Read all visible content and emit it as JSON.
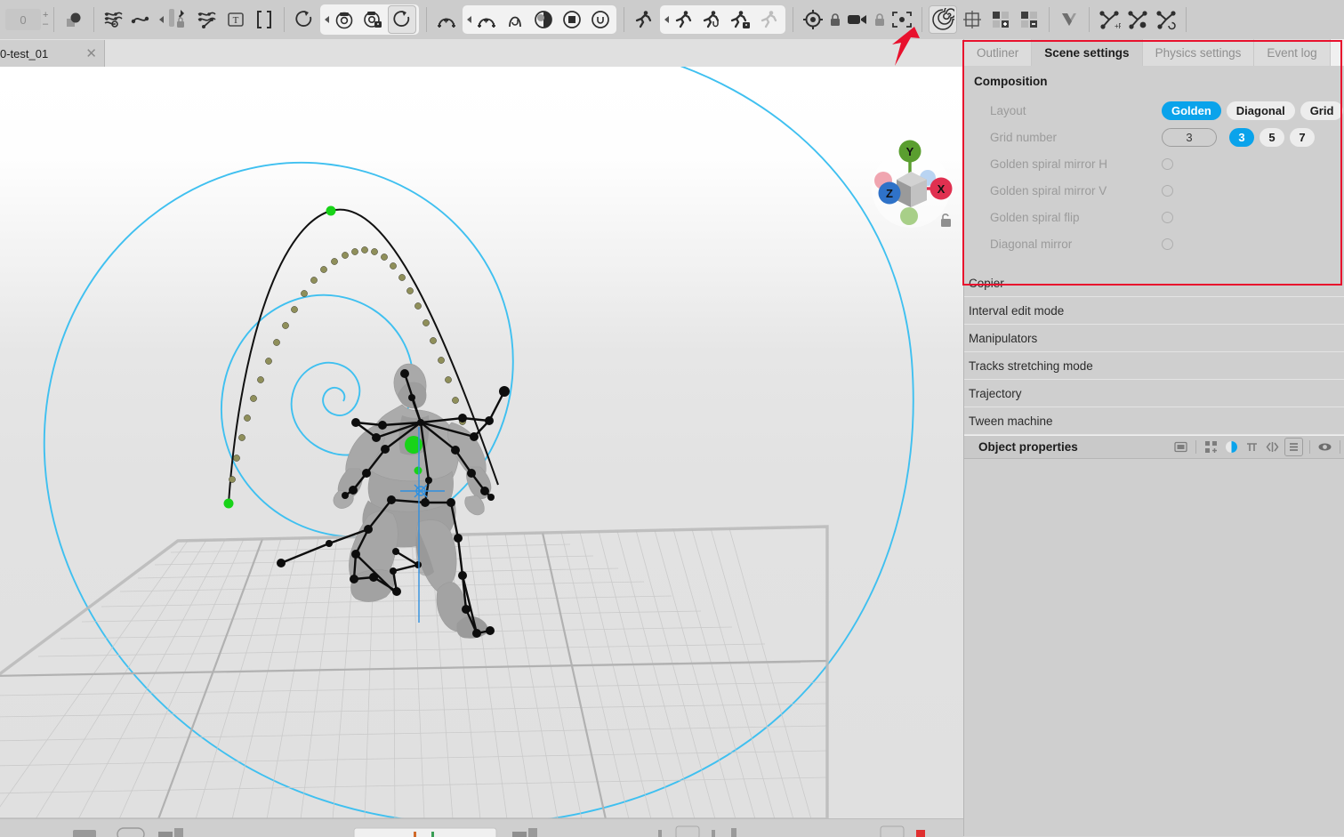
{
  "app": {
    "document_tab": {
      "label": "0-test_01",
      "close": "✕"
    },
    "frame_spinner": {
      "value": "0",
      "increase": "+",
      "decrease": "–"
    }
  },
  "toolbar": {
    "groups": [
      {
        "name": "frame-counter",
        "buttons": []
      },
      {
        "name": "selection-tools",
        "buttons": [
          {
            "name": "ball-shape-tool-button",
            "icon": "ball-shape-icon"
          }
        ]
      },
      {
        "name": "track-tools",
        "buttons": [
          {
            "name": "tracks-overview-button",
            "icon": "tracks-eye-icon"
          },
          {
            "name": "smooth-track-button",
            "icon": "smooth-wave-icon"
          },
          {
            "name": "pin-track-button",
            "icon": "pin-lock-icon"
          },
          {
            "name": "tracks-edit-button",
            "icon": "tracks-edit-icon"
          },
          {
            "name": "text-tool-button",
            "icon": "text-box-icon"
          },
          {
            "name": "interval-brackets-button",
            "icon": "brackets-icon"
          }
        ]
      },
      {
        "name": "camera-tools",
        "buttons": [
          {
            "name": "rotate-free-button",
            "icon": "rotate-arrow-icon"
          },
          {
            "name": "camera-snapshot-button",
            "icon": "camera-icon"
          },
          {
            "name": "camera-lock-button",
            "icon": "camera-lock-icon"
          },
          {
            "name": "rotate-view-button",
            "icon": "rotate-arrow-icon"
          }
        ]
      },
      {
        "name": "physics-tools",
        "buttons": [
          {
            "name": "ballistic-arc-button",
            "icon": "arc-plus-icon"
          },
          {
            "name": "ballistic-arc-alt-button",
            "icon": "arc-plus-icon"
          },
          {
            "name": "arc-partial-button",
            "icon": "arc-u-icon"
          },
          {
            "name": "center-of-mass-button",
            "icon": "com-ball-icon"
          },
          {
            "name": "inertia-box-button",
            "icon": "inertia-box-icon"
          },
          {
            "name": "momentum-button",
            "icon": "momentum-u-icon"
          }
        ]
      },
      {
        "name": "character-tools",
        "buttons": [
          {
            "name": "run-pose-button",
            "icon": "runner-icon"
          },
          {
            "name": "run-pose-alt-button",
            "icon": "runner-icon"
          },
          {
            "name": "run-undo-button",
            "icon": "runner-undo-icon"
          },
          {
            "name": "run-lock-button",
            "icon": "runner-lock-icon"
          },
          {
            "name": "run-disabled-button",
            "icon": "runner-ghost-icon"
          }
        ]
      },
      {
        "name": "viewport-tools",
        "buttons": [
          {
            "name": "target-point-button",
            "icon": "target-icon"
          },
          {
            "name": "target-lock-button",
            "icon": "small-lock-icon"
          },
          {
            "name": "camera-object-button",
            "icon": "video-camera-icon"
          },
          {
            "name": "camera-object-lock-button",
            "icon": "small-lock-icon"
          },
          {
            "name": "focus-frame-button",
            "icon": "focus-brackets-icon"
          }
        ]
      },
      {
        "name": "composition-tools",
        "buttons": [
          {
            "name": "golden-spiral-overlay-button",
            "icon": "spiral-icon"
          },
          {
            "name": "grid-overlay-button",
            "icon": "grid-overlay-icon"
          },
          {
            "name": "add-layer-button",
            "icon": "squares-plus-icon"
          },
          {
            "name": "remove-layer-button",
            "icon": "squares-minus-icon"
          }
        ]
      },
      {
        "name": "shape-tools",
        "buttons": [
          {
            "name": "chevron-shape-button",
            "icon": "chevron-v-icon"
          }
        ]
      },
      {
        "name": "node-tools",
        "buttons": [
          {
            "name": "add-node-button",
            "icon": "node-plus-icon"
          },
          {
            "name": "node-point-button",
            "icon": "node-dot-icon"
          },
          {
            "name": "reset-node-button",
            "icon": "node-reset-icon"
          }
        ]
      }
    ]
  },
  "panel": {
    "tabs": [
      {
        "label": "Outliner",
        "selected": false
      },
      {
        "label": "Scene settings",
        "selected": true
      },
      {
        "label": "Physics settings",
        "selected": false
      },
      {
        "label": "Event log",
        "selected": false
      }
    ],
    "composition": {
      "title": "Composition",
      "layout": {
        "label": "Layout",
        "options": [
          {
            "label": "Golden",
            "selected": true
          },
          {
            "label": "Diagonal",
            "selected": false
          },
          {
            "label": "Grid",
            "selected": false
          }
        ]
      },
      "grid_number": {
        "label": "Grid number",
        "field_value": "3",
        "options": [
          {
            "label": "3",
            "selected": true
          },
          {
            "label": "5",
            "selected": false
          },
          {
            "label": "7",
            "selected": false
          }
        ]
      },
      "toggles": [
        {
          "label": "Golden spiral mirror H",
          "checked": false
        },
        {
          "label": "Golden spiral mirror V",
          "checked": false
        },
        {
          "label": "Golden spiral flip",
          "checked": false
        },
        {
          "label": "Diagonal mirror",
          "checked": false
        }
      ]
    },
    "sections": [
      {
        "label": "Copier"
      },
      {
        "label": "Interval edit mode"
      },
      {
        "label": "Manipulators"
      },
      {
        "label": "Tracks stretching mode"
      },
      {
        "label": "Trajectory"
      },
      {
        "label": "Tween machine"
      }
    ],
    "object_properties": {
      "title": "Object properties",
      "icons": [
        {
          "name": "panel-window-icon",
          "boxed": false
        },
        {
          "name": "joints-icon",
          "boxed": false
        },
        {
          "name": "color-sphere-icon",
          "boxed": false
        },
        {
          "name": "pi-symbol-icon",
          "boxed": false
        },
        {
          "name": "code-brackets-icon",
          "boxed": false
        },
        {
          "name": "list-lines-icon",
          "boxed": true
        },
        {
          "name": "eye-visibility-icon",
          "boxed": false
        }
      ]
    }
  },
  "viewport": {
    "axis_gizmo": {
      "axes": [
        {
          "label": "Y",
          "color": "#5a9e2f"
        },
        {
          "label": "X",
          "color": "#e03050"
        },
        {
          "label": "Z",
          "color": "#2f72c8"
        }
      ],
      "lock_icon": "padlock-icon"
    },
    "overlay": {
      "golden_spiral_color": "#3fc0f0",
      "trajectory_color": "#111111",
      "keyframe_color": "#18d318",
      "interpolated_color": "#8f8f5a",
      "pivot_color": "#2f90e0"
    }
  },
  "annotations": {
    "highlight_color": "#e8112d",
    "arrow": {
      "name": "pointer-arrow",
      "target": "golden-spiral-overlay-button"
    },
    "rect": {
      "name": "scene-settings-highlight"
    }
  }
}
